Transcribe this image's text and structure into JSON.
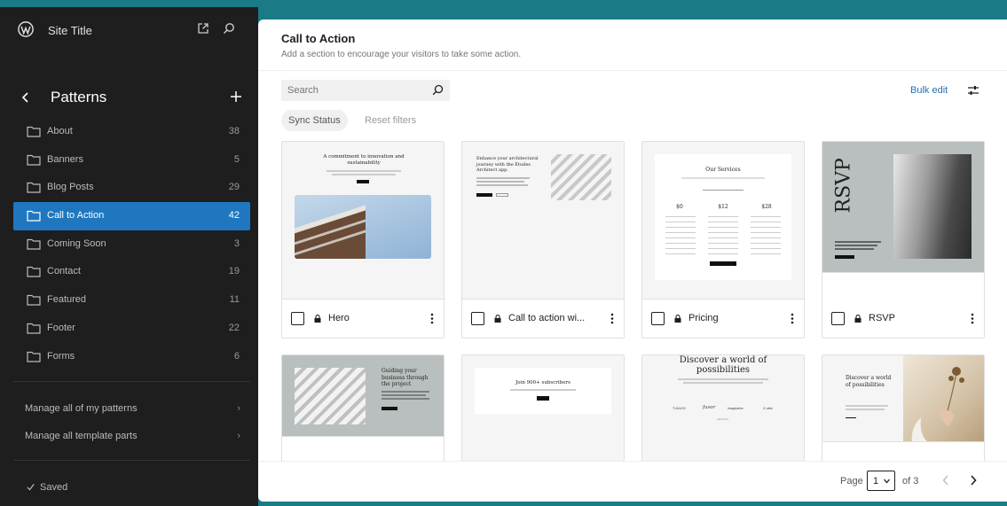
{
  "site": {
    "title": "Site Title"
  },
  "section": {
    "title": "Patterns"
  },
  "categories": [
    {
      "label": "About",
      "count": "38"
    },
    {
      "label": "Banners",
      "count": "5"
    },
    {
      "label": "Blog Posts",
      "count": "29"
    },
    {
      "label": "Call to Action",
      "count": "42"
    },
    {
      "label": "Coming Soon",
      "count": "3"
    },
    {
      "label": "Contact",
      "count": "19"
    },
    {
      "label": "Featured",
      "count": "11"
    },
    {
      "label": "Footer",
      "count": "22"
    },
    {
      "label": "Forms",
      "count": "6"
    }
  ],
  "manage": {
    "patterns": "Manage all of my patterns",
    "template_parts": "Manage all template parts",
    "chevron": "›"
  },
  "status": {
    "saved": "Saved"
  },
  "panel": {
    "title": "Call to Action",
    "description": "Add a section to encourage your visitors to take some action."
  },
  "search": {
    "placeholder": "Search"
  },
  "toolbar": {
    "bulk_edit": "Bulk edit"
  },
  "filters": {
    "sync": "Sync Status",
    "reset": "Reset filters"
  },
  "cards": [
    {
      "title": "Hero",
      "thumb": {
        "heading": "A commitment to innovation and sustainability"
      }
    },
    {
      "title": "Call to action wi...",
      "thumb": {
        "heading": "Enhance your architectural journey with the Études Architect app."
      }
    },
    {
      "title": "Pricing",
      "thumb": {
        "heading": "Our Services",
        "prices": [
          "$0",
          "$12",
          "$28"
        ]
      }
    },
    {
      "title": "RSVP",
      "thumb": {
        "heading": "RSVP"
      }
    }
  ],
  "cards_row2": [
    {
      "thumb": {
        "heading": "Guiding your business through the project"
      }
    },
    {
      "thumb": {
        "heading": "Join 900+ subscribers"
      }
    },
    {
      "thumb": {
        "heading": "Discover a world of possibilities",
        "logos": [
          "TUMAGE",
          "fusor",
          "imaginative",
          "∅ wiltz",
          "HEUDON"
        ]
      }
    },
    {
      "thumb": {
        "heading": "Discover a world of possibilities"
      }
    }
  ],
  "pagination": {
    "label": "Page",
    "current": "1",
    "of": "of 3"
  },
  "colors": {
    "accent": "#1f77c0",
    "sidebar": "#1e1e1e",
    "frame": "#1a7a85",
    "link": "#2271b1"
  }
}
